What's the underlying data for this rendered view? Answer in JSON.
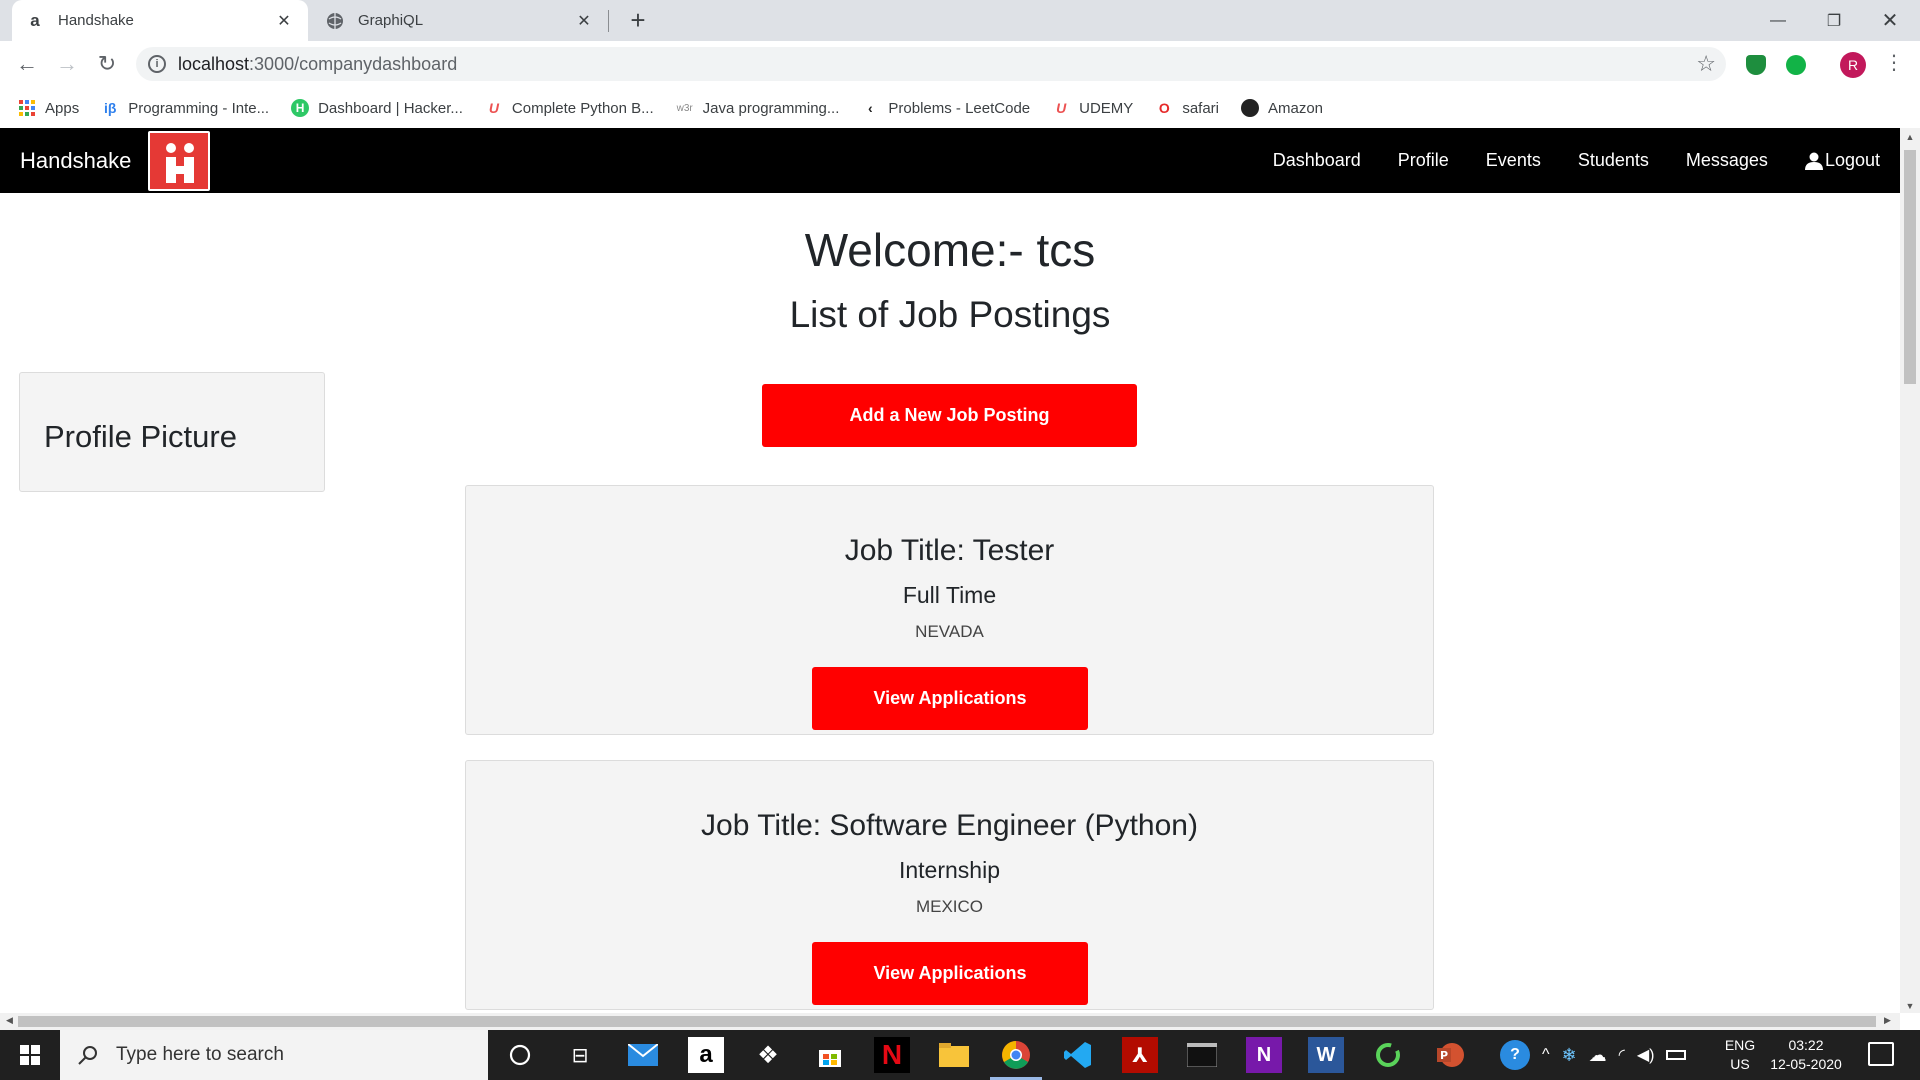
{
  "browser": {
    "tabs": [
      {
        "title": "Handshake",
        "favicon": "amazon-a",
        "active": true
      },
      {
        "title": "GraphiQL",
        "favicon": "globe-icon",
        "active": false
      }
    ],
    "url_host": "localhost",
    "url_path": ":3000/companydashboard",
    "profile_initial": "R",
    "bookmarks": [
      {
        "label": "Apps",
        "icon": "apps-grid-icon"
      },
      {
        "label": "Programming - Inte...",
        "icon": "ib-icon"
      },
      {
        "label": "Dashboard | Hacker...",
        "icon": "hackerrank-icon"
      },
      {
        "label": "Complete Python B...",
        "icon": "udemy-icon"
      },
      {
        "label": "Java programming...",
        "icon": "w3-icon"
      },
      {
        "label": "Problems - LeetCode",
        "icon": "leetcode-icon"
      },
      {
        "label": "UDEMY",
        "icon": "udemy-icon"
      },
      {
        "label": "safari",
        "icon": "opera-icon"
      },
      {
        "label": "Amazon",
        "icon": "github-icon"
      }
    ]
  },
  "app": {
    "brand": "Handshake",
    "nav": [
      "Dashboard",
      "Profile",
      "Events",
      "Students",
      "Messages",
      "Logout"
    ],
    "welcome": "Welcome:- tcs",
    "subheading": "List of Job Postings",
    "profile_card_label": "Profile Picture",
    "add_button": "Add a New Job Posting",
    "jobs": [
      {
        "title": "Job Title: Tester",
        "type": "Full Time",
        "location": "NEVADA",
        "button": "View Applications"
      },
      {
        "title": "Job Title: Software Engineer (Python)",
        "type": "Internship",
        "location": "MEXICO",
        "button": "View Applications"
      }
    ],
    "colors": {
      "accent": "#ff0000",
      "navbar": "#000000",
      "card": "#f4f4f4"
    }
  },
  "taskbar": {
    "search_placeholder": "Type here to search",
    "lang_top": "ENG",
    "lang_bottom": "US",
    "time": "03:22",
    "date": "12-05-2020"
  }
}
